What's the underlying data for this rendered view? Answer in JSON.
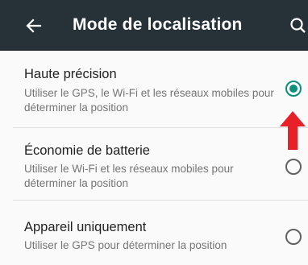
{
  "appbar": {
    "title": "Mode de localisation",
    "back_icon": "arrow-left-icon",
    "search_icon": "search-icon",
    "background": "#263238"
  },
  "options": [
    {
      "title": "Haute précision",
      "description": "Utiliser le GPS, le Wi-Fi et les réseaux mobiles pour déterminer la position",
      "selected": true
    },
    {
      "title": "Économie de batterie",
      "description": "Utiliser le Wi-Fi et les réseaux mobiles pour déterminer la position",
      "selected": false
    },
    {
      "title": "Appareil uniquement",
      "description": "Utiliser le GPS pour déterminer la position",
      "selected": false
    }
  ],
  "colors": {
    "accent": "#0d8f7a",
    "annotation_arrow": "#e8202a"
  },
  "annotation": {
    "icon": "red-up-arrow-icon"
  }
}
